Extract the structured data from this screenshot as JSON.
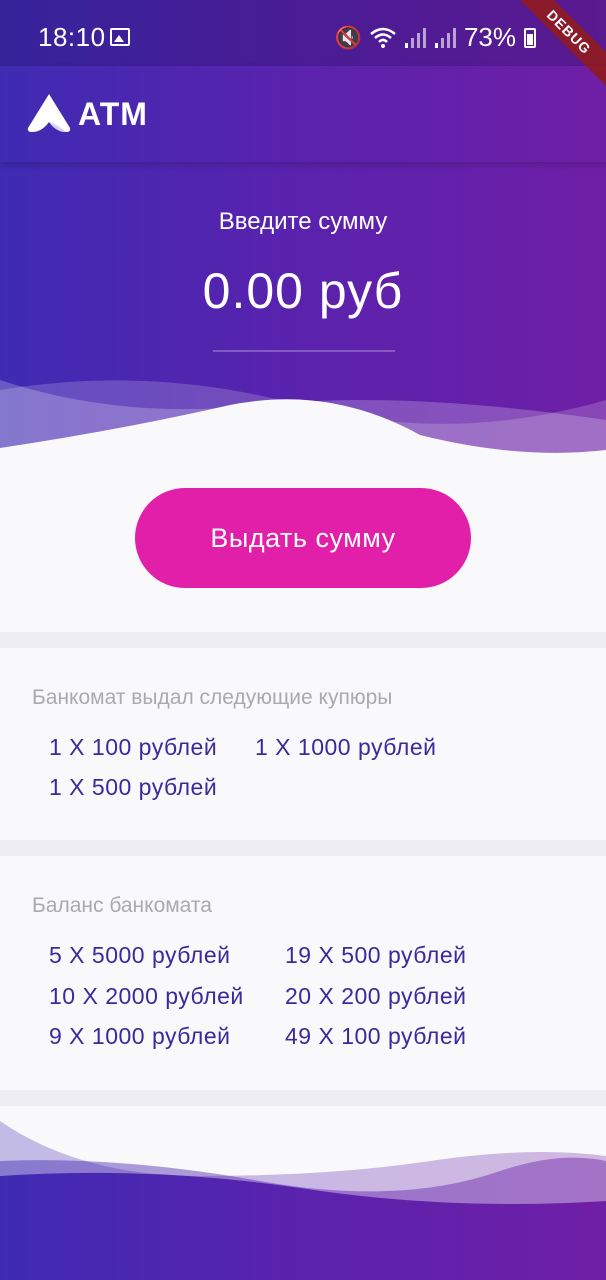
{
  "status_bar": {
    "time": "18:10",
    "battery": "73%",
    "icons": [
      "image-icon",
      "mute-icon",
      "wifi-icon",
      "signal-icon",
      "signal-icon",
      "battery-icon"
    ]
  },
  "debug_banner": "DEBUG",
  "app_bar": {
    "title": "ATM",
    "logo": "atm-logo"
  },
  "input": {
    "prompt": "Введите сумму",
    "amount": "0.00 руб"
  },
  "action": {
    "label": "Выдать сумму"
  },
  "dispensed": {
    "title": "Банкомат выдал следующие купюры",
    "notes": [
      "1 X 100 рублей",
      "1 X 1000 рублей",
      "1 X 500 рублей"
    ]
  },
  "balance": {
    "title": "Баланс банкомата",
    "notes": [
      "5 X 5000 рублей",
      "19 X 500 рублей",
      "10 X 2000 рублей",
      "20 X 200 рублей",
      "9 X 1000 рублей",
      "49 X 100 рублей"
    ]
  },
  "colors": {
    "gradient_start": "#3f2bb3",
    "gradient_end": "#6f1fa6",
    "button": "#e21fa8",
    "note_text": "#3a2a9c",
    "section_title": "#a9a9af",
    "debug": "#8b1a2b"
  }
}
